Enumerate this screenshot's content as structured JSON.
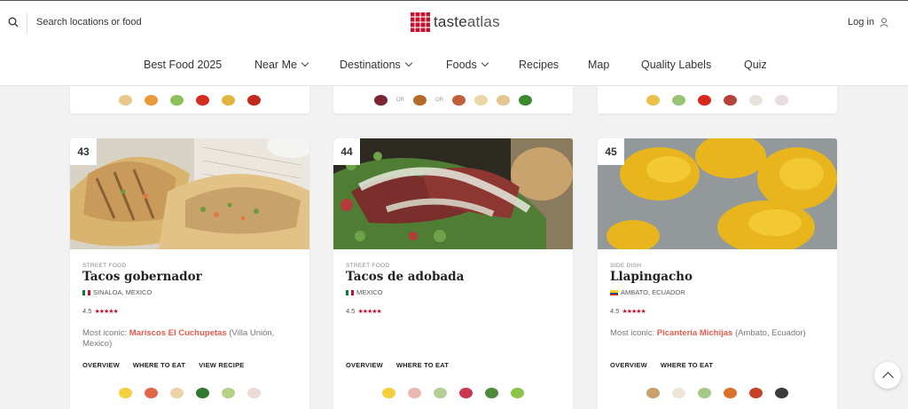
{
  "header": {
    "search_placeholder": "Search locations or food",
    "logo_text_a": "taste",
    "logo_text_b": "atlas",
    "login_label": "Log in"
  },
  "nav": [
    {
      "label": "Best Food 2025",
      "dropdown": false
    },
    {
      "label": "Near Me",
      "dropdown": true
    },
    {
      "label": "Destinations",
      "dropdown": true
    },
    {
      "label": "Foods",
      "dropdown": true
    },
    {
      "label": "Recipes",
      "dropdown": false
    },
    {
      "label": "Map",
      "dropdown": false
    },
    {
      "label": "Quality Labels",
      "dropdown": false
    },
    {
      "label": "Quiz",
      "dropdown": false
    }
  ],
  "top_stubs": [
    {
      "ingredients": [
        "#e8c88a",
        "#e99a3b",
        "#8fbf5a",
        "#d62b1f",
        "#e0b640",
        "#c32a1e"
      ],
      "or_markers": []
    },
    {
      "ingredients": [
        "#7a2434",
        "#b56a2a",
        "#c0603a",
        "#e9d7a6",
        "#e4c58f",
        "#3f8a2e"
      ],
      "or_markers": [
        "OR",
        "OR"
      ]
    },
    {
      "ingredients": [
        "#e8c04a",
        "#9ac475",
        "#d8261c",
        "#b5433a",
        "#e8e2dc",
        "#e9dce0"
      ],
      "or_markers": []
    }
  ],
  "cards": [
    {
      "rank": "43",
      "category": "STREET FOOD",
      "title": "Tacos gobernador",
      "origin": "SINALOA, MEXICO",
      "flag_colors": [
        "#0a7a3d",
        "#ffffff",
        "#c8102e"
      ],
      "rating": "4.5",
      "stars": "★★★★★",
      "iconic_prefix": "Most iconic: ",
      "iconic_place": "Mariscos El Cuchupetas",
      "iconic_suffix": " (Villa Unión, Mexico)",
      "links": [
        "OVERVIEW",
        "WHERE TO EAT",
        "VIEW RECIPE"
      ],
      "ingredients": [
        "#f4cf3f",
        "#e0664a",
        "#ecd2a6",
        "#2f7a2e",
        "#b6d189",
        "#eadbd5"
      ]
    },
    {
      "rank": "44",
      "category": "STREET FOOD",
      "title": "Tacos de adobada",
      "origin": "MEXICO",
      "flag_colors": [
        "#0a7a3d",
        "#ffffff",
        "#c8102e"
      ],
      "rating": "4.5",
      "stars": "★★★★★",
      "iconic_prefix": "",
      "iconic_place": "",
      "iconic_suffix": "",
      "links": [
        "OVERVIEW",
        "WHERE TO EAT"
      ],
      "ingredients": [
        "#f3cf3e",
        "#eab8b0",
        "#b3cf92",
        "#c9384e",
        "#4e8a3a",
        "#8cc44a"
      ]
    },
    {
      "rank": "45",
      "category": "SIDE DISH",
      "title": "Llapingacho",
      "origin": "AMBATO, ECUADOR",
      "flag_colors": [
        "#f7d117",
        "#034ea2",
        "#e1251b"
      ],
      "rating": "4.5",
      "stars": "★★★★★",
      "iconic_prefix": "Most iconic: ",
      "iconic_place": "Picantería Michijas",
      "iconic_suffix": " (Ambato, Ecuador)",
      "links": [
        "OVERVIEW",
        "WHERE TO EAT"
      ],
      "ingredients": [
        "#c8a06a",
        "#ede4d6",
        "#a6c985",
        "#d8722a",
        "#c5412a",
        "#3b3b3b"
      ]
    }
  ]
}
